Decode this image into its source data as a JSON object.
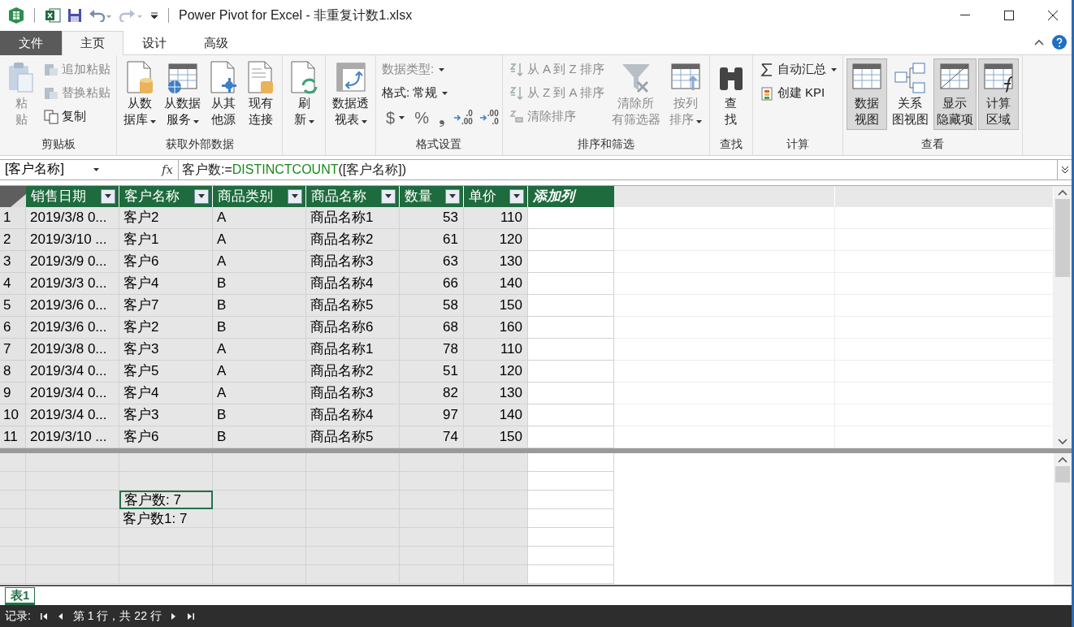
{
  "window": {
    "title": "Power Pivot for Excel - 非重复计数1.xlsx"
  },
  "ribbon_tabs": [
    {
      "label": "文件",
      "kind": "file",
      "selected": false
    },
    {
      "label": "主页",
      "kind": "tab",
      "selected": true
    },
    {
      "label": "设计",
      "kind": "tab",
      "selected": false
    },
    {
      "label": "高级",
      "kind": "tab",
      "selected": false
    }
  ],
  "ribbon": {
    "groups": [
      {
        "label": "剪贴板",
        "kind": "standard",
        "items": [
          {
            "kind": "large",
            "lines": [
              "粘",
              "贴"
            ],
            "disabled": true,
            "dropdown": false
          },
          {
            "kind": "small",
            "label": "追加粘贴",
            "disabled": true,
            "dropdown": false
          },
          {
            "kind": "small",
            "label": "替换粘贴",
            "disabled": true,
            "dropdown": false
          },
          {
            "kind": "small",
            "label": "复制",
            "disabled": false,
            "dropdown": false
          }
        ]
      },
      {
        "label": "获取外部数据",
        "kind": "standard",
        "items": [
          {
            "kind": "large",
            "lines": [
              "从数",
              "据库"
            ],
            "disabled": false,
            "dropdown": true
          },
          {
            "kind": "large",
            "lines": [
              "从数据",
              "服务"
            ],
            "disabled": false,
            "dropdown": true
          },
          {
            "kind": "large",
            "lines": [
              "从其",
              "他源"
            ],
            "disabled": false,
            "dropdown": false
          },
          {
            "kind": "large",
            "lines": [
              "现有",
              "连接"
            ],
            "disabled": false,
            "dropdown": false
          }
        ]
      },
      {
        "kind": "standard",
        "items": [
          {
            "kind": "large",
            "lines": [
              "刷",
              "新"
            ],
            "disabled": false,
            "dropdown": true
          }
        ]
      },
      {
        "kind": "standard",
        "items": [
          {
            "kind": "large",
            "lines": [
              "数据透",
              "视表"
            ],
            "disabled": false,
            "dropdown": true
          }
        ]
      },
      {
        "label": "格式设置",
        "kind": "format",
        "items": [
          {
            "kind": "small",
            "label": "数据类型:",
            "disabled": true,
            "dropdown": true
          },
          {
            "kind": "small",
            "label": "格式: 常规",
            "disabled": false,
            "dropdown": true
          },
          {
            "kind": "symbol",
            "label": "$",
            "dropdown": true
          },
          {
            "kind": "symbol",
            "label": "%",
            "dropdown": false
          },
          {
            "kind": "symbol",
            "label": "❟",
            "dropdown": false
          },
          {
            "kind": "decimal",
            "lines": [
              ".0",
              ".00"
            ]
          },
          {
            "kind": "decimal",
            "lines": [
              ".00",
              ".0"
            ]
          }
        ]
      },
      {
        "label": "排序和筛选",
        "kind": "standard",
        "items": [
          {
            "kind": "small",
            "label": "从 A 到 Z 排序",
            "disabled": true,
            "dropdown": false
          },
          {
            "kind": "small",
            "label": "从 Z 到 A 排序",
            "disabled": true,
            "dropdown": false
          },
          {
            "kind": "small",
            "label": "清除排序",
            "disabled": true,
            "dropdown": false
          },
          {
            "kind": "large",
            "lines": [
              "清除所",
              "有筛选器"
            ],
            "disabled": true,
            "dropdown": false
          },
          {
            "kind": "large",
            "lines": [
              "按列",
              "排序"
            ],
            "disabled": true,
            "dropdown": true
          }
        ]
      },
      {
        "label": "查找",
        "kind": "standard",
        "items": [
          {
            "kind": "large",
            "lines": [
              "查",
              "找"
            ],
            "disabled": false,
            "dropdown": false
          }
        ]
      },
      {
        "label": "计算",
        "kind": "standard",
        "items": [
          {
            "kind": "small",
            "label": "自动汇总",
            "disabled": false,
            "dropdown": true
          },
          {
            "kind": "small",
            "label": "创建 KPI",
            "disabled": false,
            "dropdown": false
          }
        ]
      },
      {
        "label": "查看",
        "kind": "standard",
        "items": [
          {
            "kind": "large",
            "lines": [
              "数据",
              "视图"
            ],
            "disabled": false,
            "dropdown": false,
            "selected": true
          },
          {
            "kind": "large",
            "lines": [
              "关系",
              "图视图"
            ],
            "disabled": false,
            "dropdown": false,
            "selected": false
          },
          {
            "kind": "large",
            "lines": [
              "显示",
              "隐藏项"
            ],
            "disabled": false,
            "dropdown": false,
            "selected": true
          },
          {
            "kind": "large",
            "lines": [
              "计算",
              "区域"
            ],
            "disabled": false,
            "dropdown": false,
            "selected": true
          }
        ]
      }
    ]
  },
  "formula_bar": {
    "name_box": "[客户名称]",
    "function_label": "fx",
    "formula": [
      {
        "text": "客户数:=",
        "kind": "plain"
      },
      {
        "text": "DISTINCTCOUNT",
        "kind": "function"
      },
      {
        "text": "([客户名称])",
        "kind": "plain"
      }
    ]
  },
  "table": {
    "columns": [
      {
        "label": "销售日期"
      },
      {
        "label": "客户名称"
      },
      {
        "label": "商品类别"
      },
      {
        "label": "商品名称"
      },
      {
        "label": "数量"
      },
      {
        "label": "单价"
      }
    ],
    "add_column": "添加列",
    "rows": [
      {
        "number": "1",
        "cells": [
          "2019/3/8 0...",
          "客户2",
          "A",
          "商品名称1",
          "53",
          "110"
        ]
      },
      {
        "number": "2",
        "cells": [
          "2019/3/10 ...",
          "客户1",
          "A",
          "商品名称2",
          "61",
          "120"
        ]
      },
      {
        "number": "3",
        "cells": [
          "2019/3/9 0...",
          "客户6",
          "A",
          "商品名称3",
          "63",
          "130"
        ]
      },
      {
        "number": "4",
        "cells": [
          "2019/3/3 0...",
          "客户4",
          "B",
          "商品名称4",
          "66",
          "140"
        ]
      },
      {
        "number": "5",
        "cells": [
          "2019/3/6 0...",
          "客户7",
          "B",
          "商品名称5",
          "58",
          "150"
        ]
      },
      {
        "number": "6",
        "cells": [
          "2019/3/6 0...",
          "客户2",
          "B",
          "商品名称6",
          "68",
          "160"
        ]
      },
      {
        "number": "7",
        "cells": [
          "2019/3/8 0...",
          "客户3",
          "A",
          "商品名称1",
          "78",
          "110"
        ]
      },
      {
        "number": "8",
        "cells": [
          "2019/3/4 0...",
          "客户5",
          "A",
          "商品名称2",
          "51",
          "120"
        ]
      },
      {
        "number": "9",
        "cells": [
          "2019/3/4 0...",
          "客户4",
          "A",
          "商品名称3",
          "82",
          "130"
        ]
      },
      {
        "number": "10",
        "cells": [
          "2019/3/4 0...",
          "客户3",
          "B",
          "商品名称4",
          "97",
          "140"
        ]
      },
      {
        "number": "11",
        "cells": [
          "2019/3/10 ...",
          "客户6",
          "B",
          "商品名称5",
          "74",
          "150"
        ]
      }
    ]
  },
  "calc_area": {
    "rows": [
      {},
      {},
      {
        "measure": {
          "text": "客户数: 7",
          "selected": true
        }
      },
      {
        "measure": {
          "text": "客户数1: 7",
          "selected": false
        }
      },
      {},
      {},
      {}
    ]
  },
  "sheet_tabs": [
    {
      "label": "表1",
      "selected": true
    }
  ],
  "status_bar": {
    "label": "记录:",
    "position": "第 1 行，共 22 行"
  }
}
